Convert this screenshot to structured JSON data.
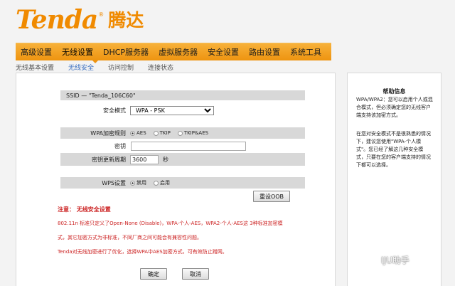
{
  "logo": {
    "en": "Tenda",
    "reg": "®",
    "cn": "腾达"
  },
  "nav": [
    "高级设置",
    "无线设置",
    "DHCP服务器",
    "虚拟服务器",
    "安全设置",
    "路由设置",
    "系统工具"
  ],
  "subnav": [
    "无线基本设置",
    "无线安全",
    "访问控制",
    "连接状态"
  ],
  "form": {
    "ssid_line": "SSID — \"Tenda_106C60\"",
    "security_mode_label": "安全模式",
    "security_mode_value": "WPA - PSK",
    "cipher_label": "WPA加密规则",
    "cipher_options": [
      "AES",
      "TKIP",
      "TKIP&AES"
    ],
    "cipher_selected": "AES",
    "key_label": "密钥",
    "key_value": "",
    "renew_label": "密钥更新周期",
    "renew_value": "3600",
    "renew_unit": "秒",
    "wps_label": "WPS设置",
    "wps_options": [
      "禁用",
      "启用"
    ],
    "wps_selected": "禁用",
    "reset_oob": "重设OOB"
  },
  "notes": {
    "title": "注意： 无线安全设置",
    "line1": "802.11n 标准只定义了Open-None (Disable)，WPA-个人-AES，WPA2-个人-AES这 3种标准加密模",
    "line2": "式，其它加密方式为非标准，不同厂商之间可能会有兼容性问题。",
    "line3": "Tenda对无线加密进行了优化，选择WPA中AES加密方式，可有效防止蹭网。"
  },
  "buttons": {
    "ok": "确定",
    "cancel": "取消"
  },
  "help": {
    "title": "帮助信息",
    "p1": "WPA/WPA2：您可以启用个人或混合模式，但必须确定您的无线客户端支持该加密方式。",
    "p2": "在您对安全模式不是很熟悉的情况下，建议您使用\"WPA-个人模式\"。您已经了解这几种安全模式，只要在您的客户端支持的情况下都可以选择。"
  },
  "watermark": "IJU助手",
  "colors": {
    "brand": "#f08a00",
    "nav": "#ee9410",
    "note": "#cc2222",
    "link": "#3a6fc0"
  }
}
